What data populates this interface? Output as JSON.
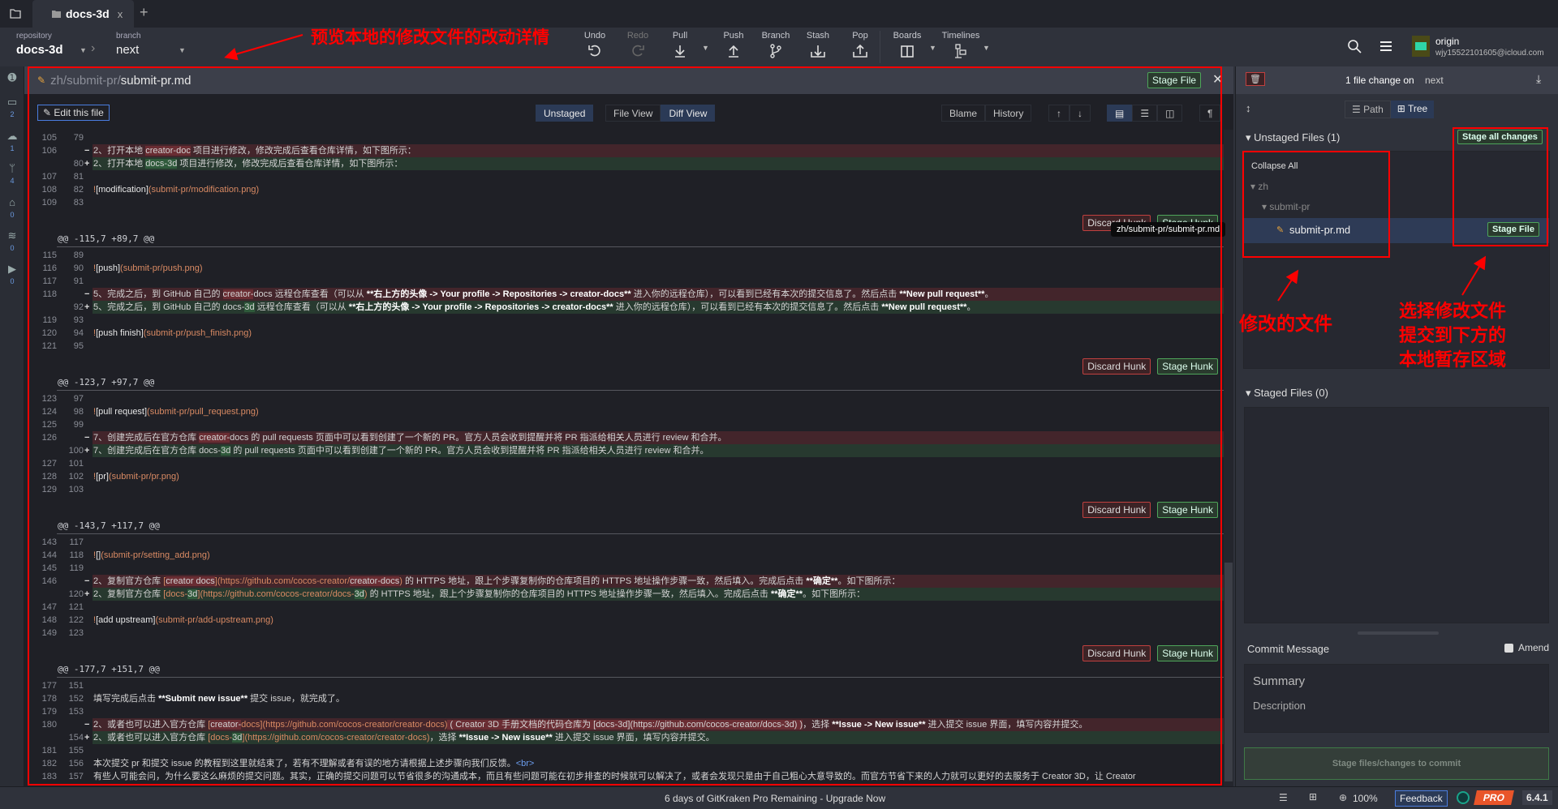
{
  "tabs": {
    "home_icon": "folder-icon",
    "active": "docs-3d",
    "close": "x",
    "add": "+"
  },
  "repo": {
    "repository_label": "repository",
    "repository": "docs-3d",
    "branch_label": "branch",
    "branch": "next"
  },
  "toolbar": {
    "undo": "Undo",
    "redo": "Redo",
    "pull": "Pull",
    "push": "Push",
    "branch": "Branch",
    "stash": "Stash",
    "pop": "Pop",
    "boards": "Boards",
    "timelines": "Timelines"
  },
  "account": {
    "remote": "origin",
    "email": "wjy15522101605@icloud.com"
  },
  "rail": {
    "counts": [
      "2",
      "1",
      "4",
      "0",
      "0",
      "0"
    ]
  },
  "file": {
    "dir": "zh/submit-pr/",
    "name": "submit-pr.md",
    "stage_file": "Stage File",
    "close": "✕"
  },
  "difftoolbar": {
    "edit": "Edit this file",
    "unstaged": "Unstaged",
    "file_view": "File View",
    "diff_view": "Diff View",
    "blame": "Blame",
    "history": "History",
    "pilcrow": "¶"
  },
  "hunk_buttons": {
    "discard": "Discard Hunk",
    "stage": "Stage Hunk"
  },
  "tooltip": "zh/submit-pr/submit-pr.md",
  "hunks": [
    {
      "header": "",
      "rows": [
        {
          "o": "105",
          "n": "79",
          "t": "ctx",
          "s": []
        },
        {
          "o": "106",
          "n": "",
          "t": "del",
          "s": [
            [
              "n",
              "2、打开本地 "
            ],
            [
              "hl",
              "creator-doc"
            ],
            [
              "n",
              " 项目进行修改，修改完成后查看仓库详情，如下图所示："
            ]
          ]
        },
        {
          "o": "",
          "n": "80",
          "t": "add",
          "s": [
            [
              "n",
              "2、打开本地 "
            ],
            [
              "hl",
              "docs-3d"
            ],
            [
              "n",
              " 项目进行修改，修改完成后查看仓库详情，如下图所示："
            ]
          ]
        },
        {
          "o": "107",
          "n": "81",
          "t": "ctx",
          "s": []
        },
        {
          "o": "108",
          "n": "82",
          "t": "ctx",
          "s": [
            [
              "link",
              "!"
            ],
            [
              "alt",
              "[modification]"
            ],
            [
              "link",
              "(submit-pr/modification.png)"
            ]
          ]
        },
        {
          "o": "109",
          "n": "83",
          "t": "ctx",
          "s": []
        }
      ]
    },
    {
      "header": "@@ -115,7 +89,7 @@",
      "rows": [
        {
          "o": "115",
          "n": "89",
          "t": "ctx",
          "s": []
        },
        {
          "o": "116",
          "n": "90",
          "t": "ctx",
          "s": [
            [
              "link",
              "!"
            ],
            [
              "alt",
              "[push]"
            ],
            [
              "link",
              "(submit-pr/push.png)"
            ]
          ]
        },
        {
          "o": "117",
          "n": "91",
          "t": "ctx",
          "s": []
        },
        {
          "o": "118",
          "n": "",
          "t": "del",
          "s": [
            [
              "n",
              "5、完成之后，到 GitHub 自己的 "
            ],
            [
              "hl",
              "creator-"
            ],
            [
              "n",
              "docs 远程仓库查看（可以从 "
            ],
            [
              "b",
              "**右上方的头像 -> Your profile -> Repositories -> creator-docs**"
            ],
            [
              "n",
              " 进入你的远程仓库），可以看到已经有本次的提交信息了。然后点击 "
            ],
            [
              "b",
              "**New pull request**"
            ],
            [
              "n",
              "。"
            ]
          ]
        },
        {
          "o": "",
          "n": "92",
          "t": "add",
          "s": [
            [
              "n",
              "5、完成之后，到 GitHub 自己的 docs-"
            ],
            [
              "hl",
              "3d"
            ],
            [
              "n",
              " 远程仓库查看（可以从 "
            ],
            [
              "b",
              "**右上方的头像 -> Your profile -> Repositories -> creator-docs**"
            ],
            [
              "n",
              " 进入你的远程仓库），可以看到已经有本次的提交信息了。然后点击 "
            ],
            [
              "b",
              "**New pull request**"
            ],
            [
              "n",
              "。"
            ]
          ]
        },
        {
          "o": "119",
          "n": "93",
          "t": "ctx",
          "s": []
        },
        {
          "o": "120",
          "n": "94",
          "t": "ctx",
          "s": [
            [
              "link",
              "!"
            ],
            [
              "alt",
              "[push finish]"
            ],
            [
              "link",
              "(submit-pr/push_finish.png)"
            ]
          ]
        },
        {
          "o": "121",
          "n": "95",
          "t": "ctx",
          "s": []
        }
      ]
    },
    {
      "header": "@@ -123,7 +97,7 @@",
      "rows": [
        {
          "o": "123",
          "n": "97",
          "t": "ctx",
          "s": []
        },
        {
          "o": "124",
          "n": "98",
          "t": "ctx",
          "s": [
            [
              "link",
              "!"
            ],
            [
              "alt",
              "[pull request]"
            ],
            [
              "link",
              "(submit-pr/pull_request.png)"
            ]
          ]
        },
        {
          "o": "125",
          "n": "99",
          "t": "ctx",
          "s": []
        },
        {
          "o": "126",
          "n": "",
          "t": "del",
          "s": [
            [
              "n",
              "7、创建完成后在官方仓库 "
            ],
            [
              "hl",
              "creator-"
            ],
            [
              "n",
              "docs 的 pull requests 页面中可以看到创建了一个新的 PR。官方人员会收到提醒并将 PR 指派给相关人员进行 review 和合并。"
            ]
          ]
        },
        {
          "o": "",
          "n": "100",
          "t": "add",
          "s": [
            [
              "n",
              "7、创建完成后在官方仓库 docs-"
            ],
            [
              "hl",
              "3d"
            ],
            [
              "n",
              " 的 pull requests 页面中可以看到创建了一个新的 PR。官方人员会收到提醒并将 PR 指派给相关人员进行 review 和合并。"
            ]
          ]
        },
        {
          "o": "127",
          "n": "101",
          "t": "ctx",
          "s": []
        },
        {
          "o": "128",
          "n": "102",
          "t": "ctx",
          "s": [
            [
              "link",
              "!"
            ],
            [
              "alt",
              "[pr]"
            ],
            [
              "link",
              "(submit-pr/pr.png)"
            ]
          ]
        },
        {
          "o": "129",
          "n": "103",
          "t": "ctx",
          "s": []
        }
      ]
    },
    {
      "header": "@@ -143,7 +117,7 @@",
      "rows": [
        {
          "o": "143",
          "n": "117",
          "t": "ctx",
          "s": []
        },
        {
          "o": "144",
          "n": "118",
          "t": "ctx",
          "s": [
            [
              "link",
              "!"
            ],
            [
              "alt",
              "[]"
            ],
            [
              "link",
              "(submit-pr/setting_add.png)"
            ]
          ]
        },
        {
          "o": "145",
          "n": "119",
          "t": "ctx",
          "s": []
        },
        {
          "o": "146",
          "n": "",
          "t": "del",
          "s": [
            [
              "n",
              "2、复制官方仓库 "
            ],
            [
              "link",
              "["
            ],
            [
              "hl",
              "creator docs"
            ],
            [
              "link",
              "](https://github.com/cocos-creator/"
            ],
            [
              "hl",
              "creator-docs"
            ],
            [
              "link",
              ")"
            ],
            [
              "n",
              " 的 HTTPS 地址，跟上个步骤复制你的仓库项目的 HTTPS 地址操作步骤一致，然后填入。完成后点击 "
            ],
            [
              "b",
              "**确定**"
            ],
            [
              "n",
              "。如下图所示："
            ]
          ]
        },
        {
          "o": "",
          "n": "120",
          "t": "add",
          "s": [
            [
              "n",
              "2、复制官方仓库 "
            ],
            [
              "link",
              "[docs-"
            ],
            [
              "hl",
              "3d"
            ],
            [
              "link",
              "](https://github.com/cocos-creator/docs-"
            ],
            [
              "hl",
              "3d"
            ],
            [
              "link",
              ")"
            ],
            [
              "n",
              " 的 HTTPS 地址，跟上个步骤复制你的仓库项目的 HTTPS 地址操作步骤一致，然后填入。完成后点击 "
            ],
            [
              "b",
              "**确定**"
            ],
            [
              "n",
              "。如下图所示："
            ]
          ]
        },
        {
          "o": "147",
          "n": "121",
          "t": "ctx",
          "s": []
        },
        {
          "o": "148",
          "n": "122",
          "t": "ctx",
          "s": [
            [
              "link",
              "!"
            ],
            [
              "alt",
              "[add upstream]"
            ],
            [
              "link",
              "(submit-pr/add-upstream.png)"
            ]
          ]
        },
        {
          "o": "149",
          "n": "123",
          "t": "ctx",
          "s": []
        }
      ]
    },
    {
      "header": "@@ -177,7 +151,7 @@",
      "rows": [
        {
          "o": "177",
          "n": "151",
          "t": "ctx",
          "s": []
        },
        {
          "o": "178",
          "n": "152",
          "t": "ctx",
          "s": [
            [
              "n",
              "填写完成后点击 "
            ],
            [
              "b",
              "**Submit new issue**"
            ],
            [
              "n",
              " 提交 issue，就完成了。"
            ]
          ]
        },
        {
          "o": "179",
          "n": "153",
          "t": "ctx",
          "s": []
        },
        {
          "o": "180",
          "n": "",
          "t": "del",
          "s": [
            [
              "n",
              "2、或者也可以进入官方仓库 "
            ],
            [
              "link",
              "["
            ],
            [
              "hl",
              "creator-"
            ],
            [
              "link",
              "docs](https://github.com/cocos-creator/creator-docs)"
            ],
            [
              "hl",
              " ( Creator 3D 手册文档的代码仓库为 [docs-3d](https://github.com/cocos-creator/docs-3d) )"
            ],
            [
              "n",
              "，选择 "
            ],
            [
              "b",
              "**Issue -> New issue**"
            ],
            [
              "n",
              " 进入提交 issue 界面，填写内容并提交。"
            ]
          ]
        },
        {
          "o": "",
          "n": "154",
          "t": "add",
          "s": [
            [
              "n",
              "2、或者也可以进入官方仓库 "
            ],
            [
              "link",
              "[docs-"
            ],
            [
              "hl",
              "3d"
            ],
            [
              "link",
              "](https://github.com/cocos-creator/creator-docs)"
            ],
            [
              "n",
              "，选择 "
            ],
            [
              "b",
              "**Issue -> New issue**"
            ],
            [
              "n",
              " 进入提交 issue 界面，填写内容并提交。"
            ]
          ]
        },
        {
          "o": "181",
          "n": "155",
          "t": "ctx",
          "s": []
        },
        {
          "o": "182",
          "n": "156",
          "t": "ctx",
          "s": [
            [
              "n",
              "本次提交 pr 和提交 issue 的教程到这里就结束了，若有不理解或者有误的地方请根据上述步骤向我们反馈。"
            ],
            [
              "tag",
              "<br>"
            ]
          ]
        },
        {
          "o": "183",
          "n": "157",
          "t": "ctx",
          "s": [
            [
              "n",
              "有些人可能会问，为什么要这么麻烦的提交问题。其实，正确的提交问题可以节省很多的沟通成本，而且有些问题可能在初步排查的时候就可以解决了，或者会发现只是由于自己粗心大意导致的。而官方节省下来的人力就可以更好的去服务于 Creator 3D，让 Creator"
            ]
          ]
        }
      ]
    }
  ],
  "right": {
    "summary": "1 file change on",
    "branch": "next",
    "path": "Path",
    "tree": "Tree",
    "unstaged_title": "Unstaged Files (1)",
    "stage_all": "Stage all changes",
    "collapse_all": "Collapse All",
    "folder1": "zh",
    "folder2": "submit-pr",
    "file": "submit-pr.md",
    "stage_file": "Stage File",
    "staged_title": "Staged Files (0)",
    "commit_message": "Commit Message",
    "amend": "Amend",
    "summary_placeholder": "Summary",
    "description_placeholder": "Description",
    "commit_button": "Stage files/changes to commit"
  },
  "status": {
    "promo": "6 days of GitKraken Pro Remaining - Upgrade Now",
    "zoom": "100%",
    "feedback": "Feedback",
    "pro": "PRO",
    "version": "6.4.1"
  },
  "annotations": {
    "diff": "预览本地的修改文件的改动详情",
    "files": "修改的文件",
    "stage": [
      "选择修改文件",
      "提交到下方的",
      "本地暂存区域"
    ],
    "color": "#ff0000"
  },
  "colors": {
    "added": "#27392f",
    "removed": "#43252b",
    "accent": "#2b3a56",
    "stage": "#4ea55a",
    "discard": "#c0403f",
    "pro": "#e9552a"
  }
}
